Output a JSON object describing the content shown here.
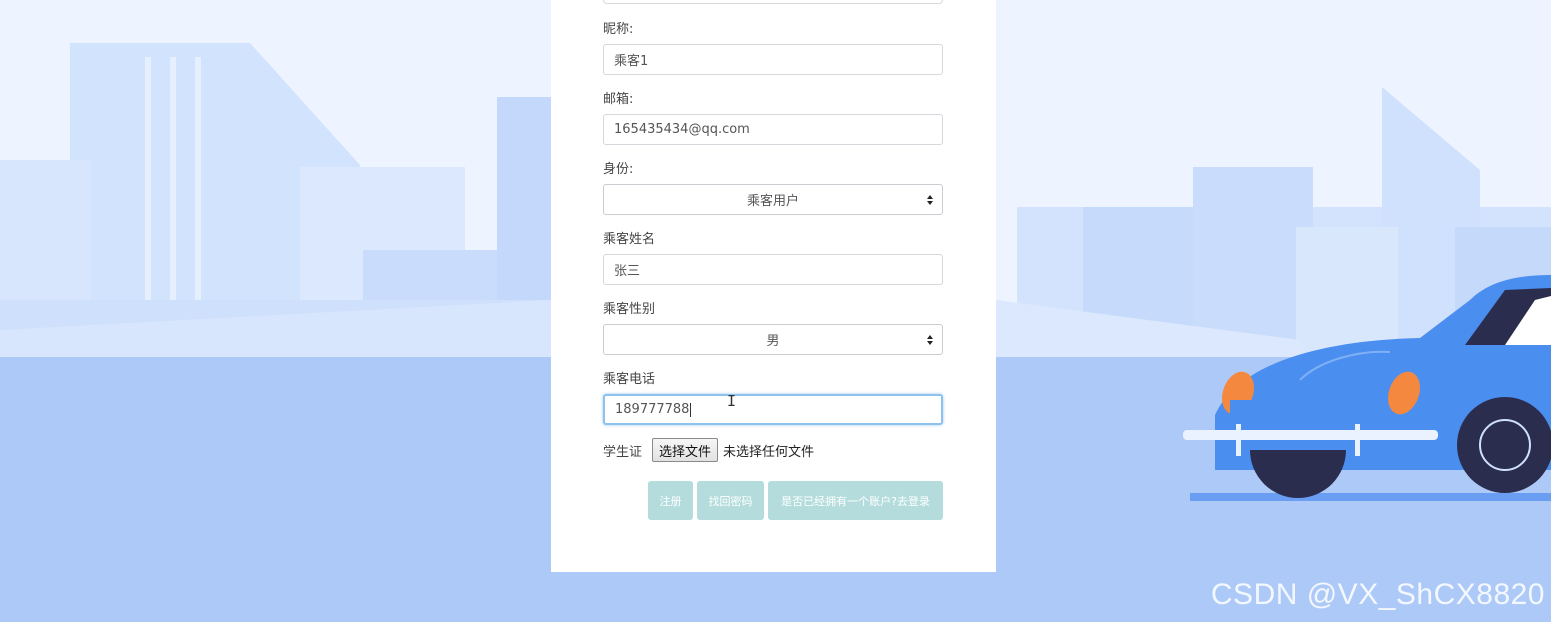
{
  "form": {
    "nickname_label": "昵称:",
    "nickname_value": "乘客1",
    "email_label": "邮箱:",
    "email_value": "165435434@qq.com",
    "identity_label": "身份:",
    "identity_selected": "乘客用户",
    "name_label": "乘客姓名",
    "name_value": "张三",
    "gender_label": "乘客性别",
    "gender_selected": "男",
    "phone_label": "乘客电话",
    "phone_value": "189777788",
    "student_card_label": "学生证",
    "file_button_label": "选择文件",
    "file_status": "未选择任何文件"
  },
  "buttons": {
    "register": "注册",
    "recover_password": "找回密码",
    "login_link": "是否已经拥有一个账户?去登录"
  },
  "watermark": "CSDN @VX_ShCX8820",
  "colors": {
    "background_sky": "#edf4ff",
    "background_ground": "#adc9f8",
    "button_bg": "#b4dcdd",
    "car_body": "#4a8ef0"
  },
  "icons": [
    "select-arrows-icon",
    "text-cursor-icon",
    "car-illustration"
  ]
}
